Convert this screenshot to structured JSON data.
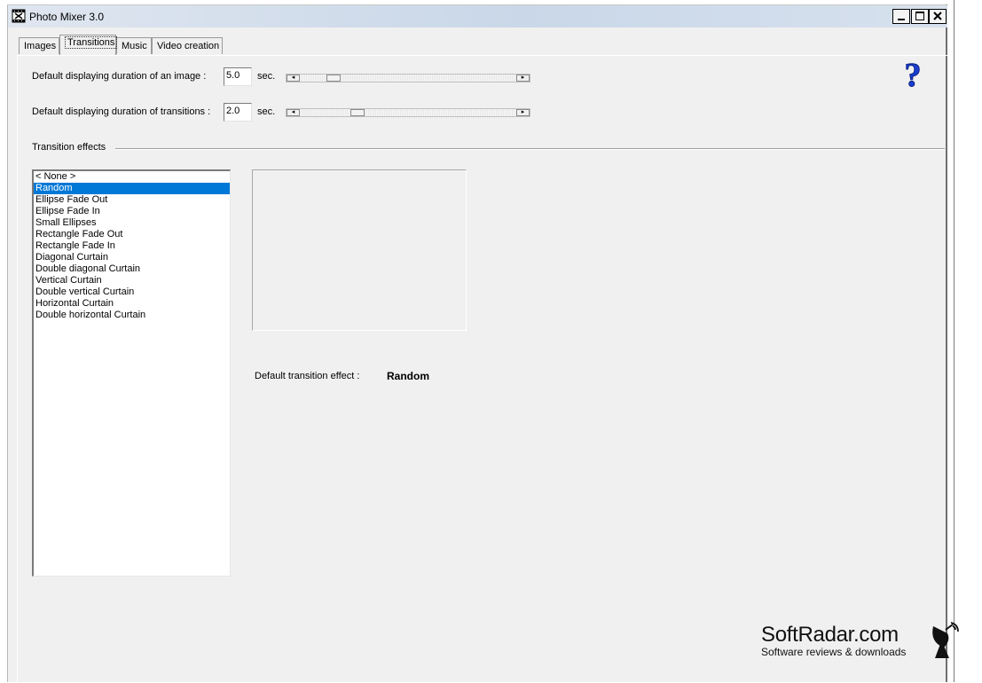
{
  "window": {
    "title": "Photo Mixer 3.0"
  },
  "tabs": [
    {
      "label": "Images"
    },
    {
      "label": "Transitions"
    },
    {
      "label": "Music"
    },
    {
      "label": "Video creation"
    }
  ],
  "settings": {
    "image_duration": {
      "label": "Default displaying duration of an image :",
      "value": "5.0",
      "unit": "sec.",
      "slider_fraction": 0.13
    },
    "transition_duration": {
      "label": "Default displaying duration of transitions :",
      "value": "2.0",
      "unit": "sec.",
      "slider_fraction": 0.25
    }
  },
  "effects": {
    "group_label": "Transition effects",
    "items": [
      "< None >",
      "Random",
      "Ellipse Fade Out",
      "Ellipse Fade In",
      "Small Ellipses",
      "Rectangle Fade Out",
      "Rectangle Fade In",
      "Diagonal Curtain",
      "Double diagonal Curtain",
      "Vertical Curtain",
      "Double vertical Curtain",
      "Horizontal Curtain",
      "Double horizontal Curtain"
    ],
    "selected_index": 1
  },
  "default_effect": {
    "label": "Default transition effect :",
    "value": "Random"
  },
  "watermark": {
    "name": "SoftRadar.com",
    "tagline": "Software reviews & downloads"
  },
  "icons": {
    "help": "help-question-icon",
    "app": "film-app-icon"
  },
  "colors": {
    "selection": "#0078d7",
    "help": "#1a3fd0"
  }
}
